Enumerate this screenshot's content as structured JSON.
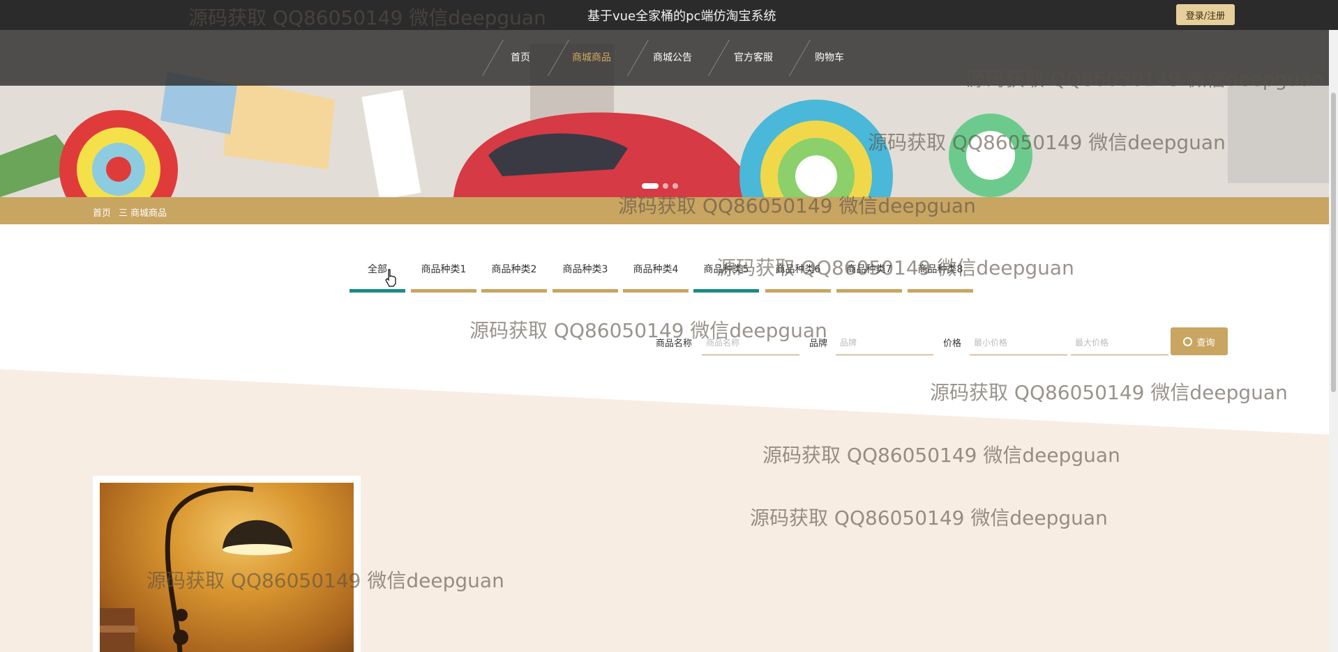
{
  "header": {
    "site_title": "基于vue全家桶的pc端仿淘宝系统",
    "login_label": "登录/注册"
  },
  "nav": {
    "items": [
      {
        "label": "首页",
        "active": false
      },
      {
        "label": "商城商品",
        "active": true
      },
      {
        "label": "商城公告",
        "active": false
      },
      {
        "label": "官方客服",
        "active": false
      },
      {
        "label": "购物车",
        "active": false
      }
    ]
  },
  "carousel": {
    "slide_count": 3,
    "active_index": 0
  },
  "breadcrumb": {
    "home": "首页",
    "separator": "三",
    "current": "商城商品"
  },
  "category_tabs": [
    {
      "label": "全部",
      "active": true
    },
    {
      "label": "商品种类1",
      "active": false
    },
    {
      "label": "商品种类2",
      "active": false
    },
    {
      "label": "商品种类3",
      "active": false
    },
    {
      "label": "商品种类4",
      "active": false
    },
    {
      "label": "商品种类5",
      "active": true
    },
    {
      "label": "商品种类6",
      "active": false
    },
    {
      "label": "商品种类7",
      "active": false
    },
    {
      "label": "商品种类8",
      "active": false
    }
  ],
  "filters": {
    "name_label": "商品名称",
    "name_placeholder": "商品名称",
    "brand_label": "品牌",
    "brand_placeholder": "品牌",
    "price_label": "价格",
    "min_price_placeholder": "最小价格",
    "max_price_placeholder": "最大价格",
    "search_label": "查询"
  },
  "watermark": "源码获取 QQ86050149 微信deepguan",
  "colors": {
    "gold": "#c9a562",
    "teal": "#1b8c86",
    "dark_bar": "#2b2b2b",
    "login_button": "#e6cf9a",
    "beige": "#f7ede2"
  }
}
